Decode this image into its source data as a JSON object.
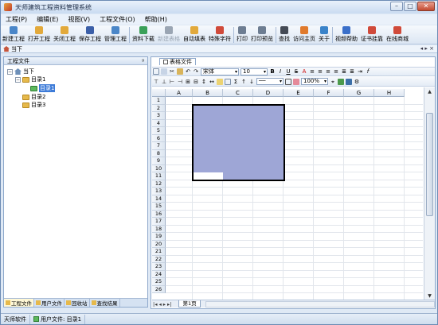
{
  "window": {
    "title": "天师建筑工程资料管理系统"
  },
  "menu": [
    "工程(P)",
    "编辑(E)",
    "视图(V)",
    "工程文件(O)",
    "帮助(H)"
  ],
  "toolbar": [
    {
      "label": "新建工程",
      "icon": "new-project-icon",
      "color": "#4a86c8",
      "disabled": false
    },
    {
      "label": "打开工程",
      "icon": "open-folder-icon",
      "color": "#e2a93b",
      "disabled": false
    },
    {
      "label": "关闭工程",
      "icon": "close-project-icon",
      "color": "#e2a93b",
      "disabled": false
    },
    {
      "label": "保存工程",
      "icon": "save-icon",
      "color": "#3b5fa8",
      "disabled": false
    },
    {
      "label": "管理工程",
      "icon": "manage-icon",
      "color": "#4a86c8",
      "disabled": false
    },
    {
      "label": "资料下载",
      "icon": "download-icon",
      "color": "#3aa058",
      "disabled": false
    },
    {
      "label": "新建表格",
      "icon": "new-table-icon",
      "color": "#9aa5b3",
      "disabled": true
    },
    {
      "label": "自动填表",
      "icon": "auto-fill-icon",
      "color": "#e2a93b",
      "disabled": false
    },
    {
      "label": "特殊字符",
      "icon": "special-char-icon",
      "color": "#d04a3a",
      "disabled": false
    },
    {
      "label": "打印",
      "icon": "print-icon",
      "color": "#6d7d92",
      "disabled": false
    },
    {
      "label": "打印预览",
      "icon": "print-preview-icon",
      "color": "#6d7d92",
      "disabled": false
    },
    {
      "label": "查找",
      "icon": "binoculars-icon",
      "color": "#444a55",
      "disabled": false
    },
    {
      "label": "访问主页",
      "icon": "home-page-icon",
      "color": "#e07a2c",
      "disabled": false
    },
    {
      "label": "关于",
      "icon": "about-icon",
      "color": "#3a83c9",
      "disabled": false
    },
    {
      "label": "视频帮助",
      "icon": "video-help-icon",
      "color": "#3a6fc9",
      "disabled": false
    },
    {
      "label": "证书挂靠",
      "icon": "certificate-icon",
      "color": "#d04a3a",
      "disabled": false
    },
    {
      "label": "在线商城",
      "icon": "cart-icon",
      "color": "#d04a3a",
      "disabled": false
    }
  ],
  "nav": {
    "current": "当下"
  },
  "left_panel": {
    "header": "工程文件",
    "pin": "ᵍ",
    "tree": [
      {
        "label": "当下",
        "level": 0,
        "type": "house",
        "expander": "−"
      },
      {
        "label": "目录1",
        "level": 1,
        "type": "folder",
        "expander": "−"
      },
      {
        "label": "目录1",
        "level": 2,
        "type": "folder-green",
        "expander": "",
        "selected": true
      },
      {
        "label": "目录2",
        "level": 1,
        "type": "folder",
        "expander": ""
      },
      {
        "label": "目录3",
        "level": 1,
        "type": "folder",
        "expander": ""
      }
    ],
    "tabs": [
      "工程文件",
      "用户文件",
      "回收站",
      "查找结果"
    ]
  },
  "document": {
    "tab": "表格文件",
    "font_name": "宋体",
    "font_size": "10",
    "zoom": "100%",
    "columns": [
      "A",
      "B",
      "C",
      "D",
      "E",
      "F",
      "G",
      "H"
    ],
    "rows": [
      "1",
      "2",
      "3",
      "4",
      "5",
      "6",
      "7",
      "8",
      "9",
      "10",
      "11",
      "12",
      "13",
      "14",
      "15",
      "16",
      "17",
      "18",
      "19",
      "20",
      "21",
      "22",
      "23",
      "24",
      "25",
      "26"
    ],
    "sheet_tab": "第1页"
  },
  "status": {
    "company": "天师软件",
    "user_file": "用户文件: 目录1"
  },
  "colors": {
    "selection": "#9ea6d6",
    "accent": "#3d7bd8"
  }
}
